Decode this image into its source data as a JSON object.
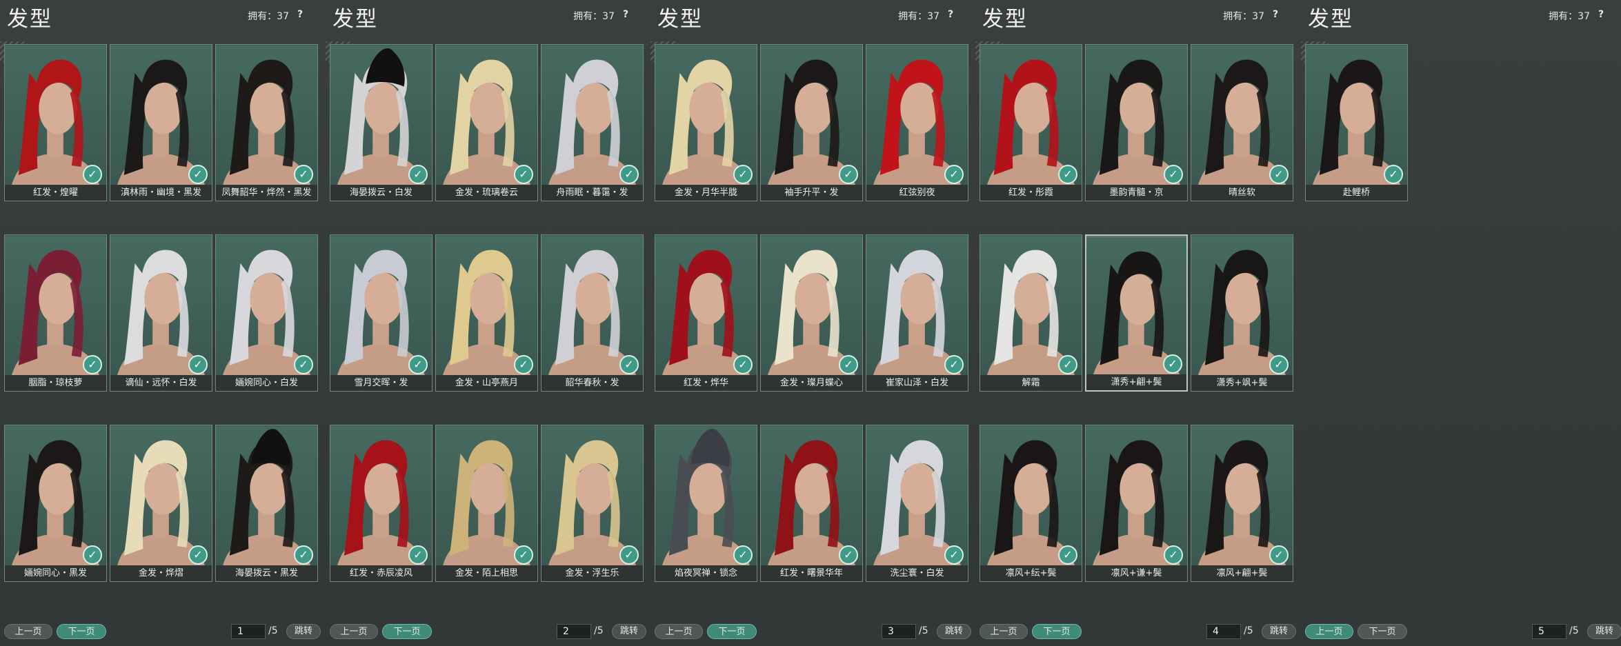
{
  "common": {
    "title": "发型",
    "owned_label": "拥有：37",
    "help": "?",
    "prev_label": "上一页",
    "next_label": "下一页",
    "total": "/5",
    "jump_label": "跳转",
    "check_glyph": "✓"
  },
  "pages": [
    {
      "page_number": "1",
      "tiles": [
        {
          "name": "红发・煌曜",
          "hair": "#b01518",
          "hat": ""
        },
        {
          "name": "滇林雨・幽境・黑发",
          "hair": "#1b1818",
          "hat": ""
        },
        {
          "name": "凤舞韶华・烨然・黑发",
          "hair": "#1d1a18",
          "hat": ""
        },
        {
          "name": "胭脂・琼枝萝",
          "hair": "#7a1e34",
          "hat": ""
        },
        {
          "name": "谪仙・远怀・白发",
          "hair": "#dcdcdf",
          "hat": ""
        },
        {
          "name": "婳婉同心・白发",
          "hair": "#d8d8dc",
          "hat": ""
        },
        {
          "name": "婳婉同心・黑发",
          "hair": "#1b1817",
          "hat": ""
        },
        {
          "name": "金发・烨熠",
          "hair": "#e8dcb8",
          "hat": ""
        },
        {
          "name": "海晏拨云・黑发",
          "hair": "#1d1a18",
          "hat": "#111"
        }
      ]
    },
    {
      "page_number": "2",
      "tiles": [
        {
          "name": "海晏拨云・白发",
          "hair": "#d4d3d6",
          "hat": "#111"
        },
        {
          "name": "金发・琉璃卷云",
          "hair": "#e2d3a4",
          "hat": ""
        },
        {
          "name": "舟雨眠・暮霭・发",
          "hair": "#cfd0d6",
          "hat": ""
        },
        {
          "name": "雪月交晖・发",
          "hair": "#c9cbd4",
          "hat": ""
        },
        {
          "name": "金发・山亭燕月",
          "hair": "#dec98f",
          "hat": ""
        },
        {
          "name": "韶华春秋・发",
          "hair": "#d0d0d4",
          "hat": ""
        },
        {
          "name": "红发・赤辰凌风",
          "hair": "#a51218",
          "hat": ""
        },
        {
          "name": "金发・陌上相思",
          "hair": "#cdb27a",
          "hat": ""
        },
        {
          "name": "金发・浮生乐",
          "hair": "#d9c58f",
          "hat": ""
        }
      ]
    },
    {
      "page_number": "3",
      "tiles": [
        {
          "name": "金发・月华半胧",
          "hair": "#e3d4a6",
          "hat": ""
        },
        {
          "name": "袖手升平・发",
          "hair": "#1c1818",
          "hat": ""
        },
        {
          "name": "红弦别夜",
          "hair": "#c0141a",
          "hat": ""
        },
        {
          "name": "红发・烨华",
          "hair": "#a0101a",
          "hat": ""
        },
        {
          "name": "金发・璨月蝶心",
          "hair": "#e9e3cc",
          "hat": ""
        },
        {
          "name": "崔家山泽・白发",
          "hair": "#d4d6de",
          "hat": ""
        },
        {
          "name": "焰夜冥禅・锁念",
          "hair": "#4a4c54",
          "hat": "#3c3e45"
        },
        {
          "name": "红发・曙景华年",
          "hair": "#8f1217",
          "hat": ""
        },
        {
          "name": "洗尘寰・白发",
          "hair": "#d6d7dc",
          "hat": ""
        }
      ]
    },
    {
      "page_number": "4",
      "tiles": [
        {
          "name": "红发・彤霞",
          "hair": "#b3121a",
          "hat": ""
        },
        {
          "name": "墨韵青髓・京",
          "hair": "#1a1717",
          "hat": ""
        },
        {
          "name": "晴丝软",
          "hair": "#1c1817",
          "hat": ""
        },
        {
          "name": "解霜",
          "hair": "#e4e4e2",
          "hat": ""
        },
        {
          "name": "潇秀+翩+鬓",
          "hair": "#181515",
          "hat": ""
        },
        {
          "name": "潇秀+飒+鬓",
          "hair": "#191616",
          "hat": ""
        },
        {
          "name": "凛风+纭+鬓",
          "hair": "#1a1616",
          "hat": ""
        },
        {
          "name": "凛风+谦+鬓",
          "hair": "#1a1616",
          "hat": ""
        },
        {
          "name": "凛风+翩+鬓",
          "hair": "#1b1717",
          "hat": ""
        }
      ]
    },
    {
      "page_number": "5",
      "tiles": [
        {
          "name": "赴鲤桥",
          "hair": "#1b1716",
          "hat": ""
        }
      ]
    }
  ],
  "selected": {
    "page": 3,
    "index": 4
  },
  "colors": {
    "accent": "#3f8a79",
    "tile_bg": "#3e5a52",
    "caption_bg": "#2f3433"
  }
}
